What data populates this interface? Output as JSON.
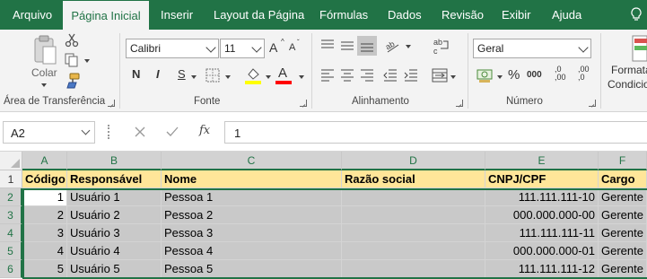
{
  "tabs": [
    "Arquivo",
    "Página Inicial",
    "Inserir",
    "Layout da Página",
    "Fórmulas",
    "Dados",
    "Revisão",
    "Exibir",
    "Ajuda"
  ],
  "ribbon": {
    "clipboard": {
      "label": "Área de Transferência",
      "paste_label": "Colar"
    },
    "font": {
      "label": "Fonte",
      "name": "Calibri",
      "size": "11",
      "bold": "N",
      "italic": "I",
      "underline": "S",
      "grow": "A",
      "shrink": "A",
      "color_letter": "A"
    },
    "alignment": {
      "label": "Alinhamento"
    },
    "number": {
      "label": "Número",
      "format": "Geral",
      "percent": "%",
      "comma": "000",
      "inc_decimal": ",0\n,00",
      "dec_decimal": ",00\n,0"
    },
    "styles": {
      "label_line1": "Formata",
      "label_line2": "Condicio"
    }
  },
  "formula_bar": {
    "name_box": "A2",
    "fx": "fx",
    "value": "1"
  },
  "sheet": {
    "columns": [
      "A",
      "B",
      "C",
      "D",
      "E",
      "F"
    ],
    "rows": [
      "1",
      "2",
      "3",
      "4",
      "5",
      "6"
    ],
    "header": [
      "Código",
      "Responsável",
      "Nome",
      "Razão social",
      "CNPJ/CPF",
      "Cargo"
    ],
    "data": [
      [
        "1",
        "Usuário 1",
        "Pessoa 1",
        "",
        "111.111.111-10",
        "Gerente"
      ],
      [
        "2",
        "Usuário 2",
        "Pessoa 2",
        "",
        "000.000.000-00",
        "Gerente"
      ],
      [
        "3",
        "Usuário 3",
        "Pessoa 3",
        "",
        "111.111.111-11",
        "Gerente"
      ],
      [
        "4",
        "Usuário 4",
        "Pessoa 4",
        "",
        "000.000.000-01",
        "Gerente"
      ],
      [
        "5",
        "Usuário 5",
        "Pessoa 5",
        "",
        "111.111.111-12",
        "Gerente"
      ]
    ]
  },
  "colors": {
    "accent": "#217346",
    "header_fill": "#ffe699",
    "selection_fill": "#c9c9c9"
  }
}
